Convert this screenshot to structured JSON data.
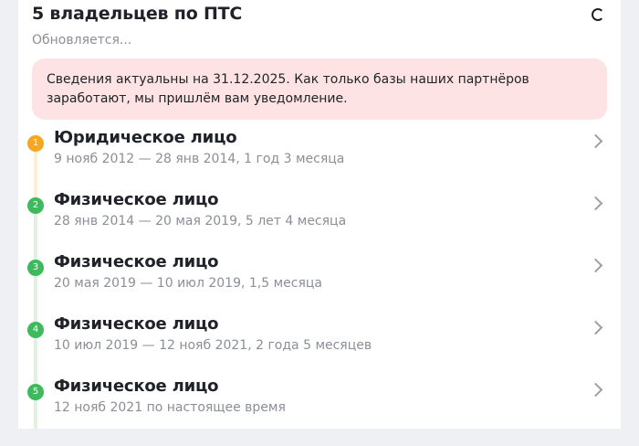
{
  "header": {
    "title": "5 владельцев по ПТС",
    "status": "Обновляется..."
  },
  "notice": {
    "text": "Сведения актуальны на 31.12.2025. Как только базы наших партнёров заработают, мы пришлём вам уведомление.",
    "color": "#fde3e3"
  },
  "owners": [
    {
      "number": "1",
      "title": "Юридическое лицо",
      "period": "9 нояб 2012 — 28 янв 2014, 1 год 3 месяца",
      "color": "#f5a623"
    },
    {
      "number": "2",
      "title": "Физическое лицо",
      "period": "28 янв 2014 — 20 мая 2019, 5 лет 4 месяца",
      "color": "#3dbb5c"
    },
    {
      "number": "3",
      "title": "Физическое лицо",
      "period": "20 мая 2019 — 10 июл 2019, 1,5 месяца",
      "color": "#3dbb5c"
    },
    {
      "number": "4",
      "title": "Физическое лицо",
      "period": "10 июл 2019 — 12 нояб 2021, 2 года 5 месяцев",
      "color": "#3dbb5c"
    },
    {
      "number": "5",
      "title": "Физическое лицо",
      "period": "12 нояб 2021 по настоящее время",
      "color": "#3dbb5c"
    }
  ],
  "icons": {
    "loading": "spinner-icon",
    "open": "chevron-right-icon"
  }
}
